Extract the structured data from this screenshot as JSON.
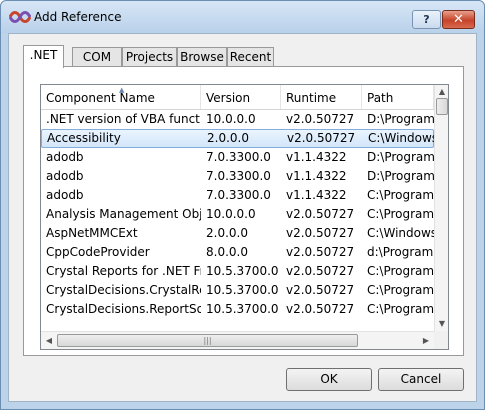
{
  "window": {
    "title": "Add Reference",
    "help_label": "?",
    "close_label": "✕"
  },
  "tabs": [
    ".NET",
    "COM",
    "Projects",
    "Browse",
    "Recent"
  ],
  "active_tab": ".NET",
  "list": {
    "columns": [
      "Component Name",
      "Version",
      "Runtime",
      "Path"
    ],
    "rows": [
      [
        ".NET version of VBA functi...",
        "10.0.0.0",
        "v2.0.50727",
        "D:\\Programe"
      ],
      [
        "Accessibility",
        "2.0.0.0",
        "v2.0.50727",
        "C:\\Windows\\"
      ],
      [
        "adodb",
        "7.0.3300.0",
        "v1.1.4322",
        "D:\\Programe"
      ],
      [
        "adodb",
        "7.0.3300.0",
        "v1.1.4322",
        "D:\\Programe"
      ],
      [
        "adodb",
        "7.0.3300.0",
        "v1.1.4322",
        "C:\\Program"
      ],
      [
        "Analysis Management Obj...",
        "10.0.0.0",
        "v2.0.50727",
        "C:\\Program"
      ],
      [
        "AspNetMMCExt",
        "2.0.0.0",
        "v2.0.50727",
        "C:\\Windows\\"
      ],
      [
        "CppCodeProvider",
        "8.0.0.0",
        "v2.0.50727",
        "d:\\Programe"
      ],
      [
        "Crystal Reports for .NET Fr...",
        "10.5.3700.0",
        "v2.0.50727",
        "C:\\Program"
      ],
      [
        "CrystalDecisions.CrystalRe...",
        "10.5.3700.0",
        "v2.0.50727",
        "C:\\Program"
      ],
      [
        "CrystalDecisions.ReportSo...",
        "10.5.3700.0",
        "v2.0.50727",
        "C:\\Program"
      ]
    ],
    "selected_row": "Accessibility"
  },
  "buttons": {
    "ok": "OK",
    "cancel": "Cancel"
  }
}
